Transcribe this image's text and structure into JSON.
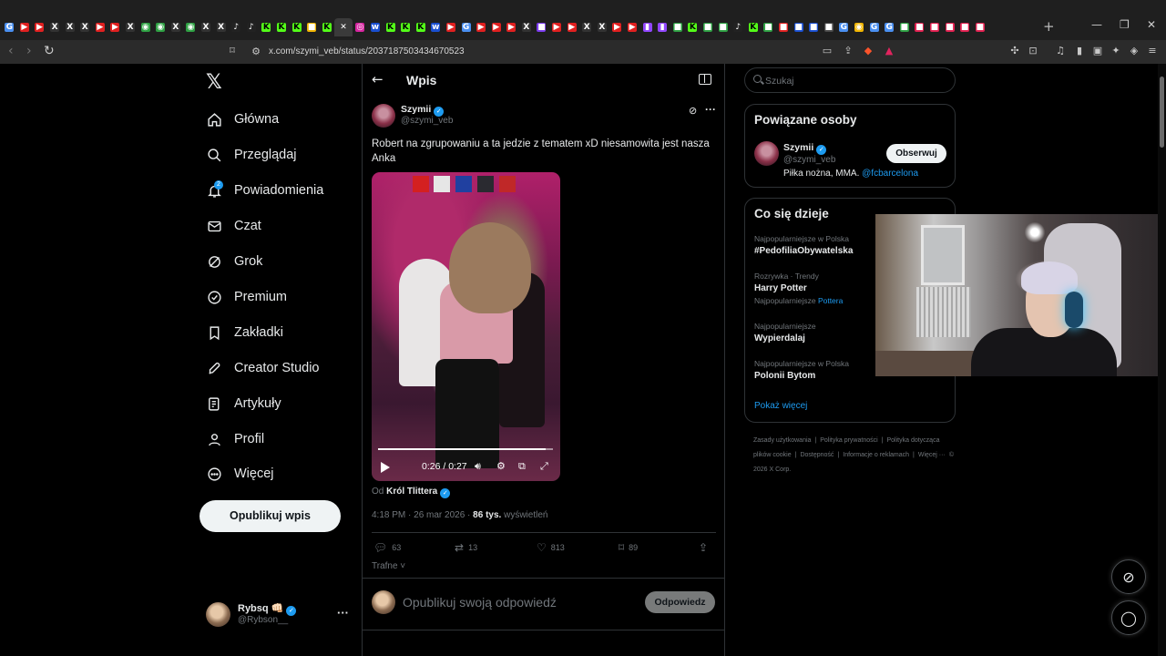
{
  "browser": {
    "tab_favicons": [
      {
        "icon": "google-icon",
        "color": "#4a8ff0"
      },
      {
        "icon": "youtube-icon",
        "color": "#e02020"
      },
      {
        "icon": "youtube-icon",
        "color": "#e02020"
      },
      {
        "icon": "x-icon",
        "color": "#333333"
      },
      {
        "icon": "x-icon",
        "color": "#333333"
      },
      {
        "icon": "x-icon",
        "color": "#333333"
      },
      {
        "icon": "youtube-icon",
        "color": "#e02020"
      },
      {
        "icon": "youtube-icon",
        "color": "#e02020"
      },
      {
        "icon": "x-icon",
        "color": "#333333"
      },
      {
        "icon": "maps-icon",
        "color": "#2ea043"
      },
      {
        "icon": "maps-icon",
        "color": "#2ea043"
      },
      {
        "icon": "x-icon",
        "color": "#333333"
      },
      {
        "icon": "maps-icon",
        "color": "#2ea043"
      },
      {
        "icon": "x-icon",
        "color": "#333333"
      },
      {
        "icon": "x-icon",
        "color": "#333333"
      },
      {
        "icon": "tiktok-icon",
        "color": "#222222"
      },
      {
        "icon": "tiktok-icon",
        "color": "#222222"
      },
      {
        "icon": "kick-icon",
        "color": "#53fc18"
      },
      {
        "icon": "kick-icon",
        "color": "#53fc18"
      },
      {
        "icon": "kick-icon",
        "color": "#53fc18"
      },
      {
        "icon": "app-icon",
        "color": "#f0b400"
      },
      {
        "icon": "kick-icon",
        "color": "#53fc18"
      },
      {
        "icon": "close-icon",
        "color": "#3a3a3a",
        "active": true
      },
      {
        "icon": "instagram-icon",
        "color": "#d6249f"
      },
      {
        "icon": "wp-icon",
        "color": "#1a4fd0"
      },
      {
        "icon": "kick-icon",
        "color": "#53fc18"
      },
      {
        "icon": "kick-icon",
        "color": "#53fc18"
      },
      {
        "icon": "kick-icon",
        "color": "#53fc18"
      },
      {
        "icon": "wp-icon",
        "color": "#1a4fd0"
      },
      {
        "icon": "youtube-icon",
        "color": "#e02020"
      },
      {
        "icon": "google-icon",
        "color": "#4a8ff0"
      },
      {
        "icon": "youtube-icon",
        "color": "#e02020"
      },
      {
        "icon": "youtube-icon",
        "color": "#e02020"
      },
      {
        "icon": "youtube-icon",
        "color": "#e02020"
      },
      {
        "icon": "x-icon",
        "color": "#333333"
      },
      {
        "icon": "app-icon",
        "color": "#7a3aed"
      },
      {
        "icon": "youtube-icon",
        "color": "#e02020"
      },
      {
        "icon": "youtube-icon",
        "color": "#e02020"
      },
      {
        "icon": "x-icon",
        "color": "#333333"
      },
      {
        "icon": "x-icon",
        "color": "#333333"
      },
      {
        "icon": "youtube-icon",
        "color": "#e02020"
      },
      {
        "icon": "youtube-icon",
        "color": "#e02020"
      },
      {
        "icon": "twitch-icon",
        "color": "#9146ff"
      },
      {
        "icon": "twitch-icon",
        "color": "#9146ff"
      },
      {
        "icon": "app-icon",
        "color": "#2ea043"
      },
      {
        "icon": "kick-icon",
        "color": "#53fc18"
      },
      {
        "icon": "app-icon",
        "color": "#2ea043"
      },
      {
        "icon": "app-icon",
        "color": "#2ea043"
      },
      {
        "icon": "tiktok-icon",
        "color": "#222222"
      },
      {
        "icon": "kick-icon",
        "color": "#53fc18"
      },
      {
        "icon": "app-icon",
        "color": "#2ea043"
      },
      {
        "icon": "app-icon",
        "color": "#e02020"
      },
      {
        "icon": "app-icon",
        "color": "#1a4fd0"
      },
      {
        "icon": "app-icon",
        "color": "#1a4fd0"
      },
      {
        "icon": "app-icon",
        "color": "#4a4a4a"
      },
      {
        "icon": "google-icon",
        "color": "#4a8ff0"
      },
      {
        "icon": "chrome-icon",
        "color": "#f0b400"
      },
      {
        "icon": "google-icon",
        "color": "#4a8ff0"
      },
      {
        "icon": "google-icon",
        "color": "#4a8ff0"
      },
      {
        "icon": "app-icon",
        "color": "#2ea043"
      },
      {
        "icon": "app-icon",
        "color": "#e02050"
      },
      {
        "icon": "app-icon",
        "color": "#e02050"
      },
      {
        "icon": "app-icon",
        "color": "#e02050"
      },
      {
        "icon": "app-icon",
        "color": "#e02050"
      },
      {
        "icon": "app-icon",
        "color": "#e02050"
      }
    ],
    "url": "x.com/szymi_veb/status/2037187503434670523",
    "colors": {
      "tabbar": "#1f1f1f",
      "toolbar": "#2b2b2b"
    }
  },
  "nav": {
    "items": [
      {
        "label": "Główna",
        "icon": "home-icon"
      },
      {
        "label": "Przeglądaj",
        "icon": "search-icon"
      },
      {
        "label": "Powiadomienia",
        "icon": "bell-icon",
        "badge": "2"
      },
      {
        "label": "Czat",
        "icon": "mail-icon"
      },
      {
        "label": "Grok",
        "icon": "grok-icon"
      },
      {
        "label": "Premium",
        "icon": "premium-icon"
      },
      {
        "label": "Zakładki",
        "icon": "bookmark-icon"
      },
      {
        "label": "Creator Studio",
        "icon": "rocket-icon"
      },
      {
        "label": "Artykuły",
        "icon": "article-icon"
      },
      {
        "label": "Profil",
        "icon": "person-icon"
      },
      {
        "label": "Więcej",
        "icon": "more-circle-icon"
      }
    ],
    "publish_label": "Opublikuj wpis",
    "account": {
      "name": "Rybsq 👊🏻",
      "handle": "@Rybson__"
    }
  },
  "post": {
    "header_title": "Wpis",
    "author_name": "Szymii",
    "author_handle": "@szymi_veb",
    "text": "Robert na zgrupowaniu a ta jedzie z tematem xD niesamowita jest nasza Anka",
    "video_time": "0:26 / 0:27",
    "video_progress": 0.96,
    "from_prefix": "Od",
    "from_account": "Król Tlittera",
    "time_date": "4:18 PM · 26 mar 2026 · ",
    "views_count": "86 tys.",
    "views_label": " wyświetleń",
    "actions": {
      "replies": "63",
      "reposts": "13",
      "likes": "813",
      "bookmarks": "89"
    },
    "sort_label": "Trafne",
    "reply_placeholder": "Opublikuj swoją odpowiedź",
    "reply_button": "Odpowiedz"
  },
  "sidebar": {
    "search_placeholder": "Szukaj",
    "related_title": "Powiązane osoby",
    "person": {
      "name": "Szymii",
      "handle": "@szymi_veb",
      "bio_text": "Piłka nożna, MMA. ",
      "bio_link": "@fcbarcelona",
      "follow_label": "Obserwuj"
    },
    "trends_title": "Co się dzieje",
    "trends": [
      {
        "category": "Najpopularniejsze w Polska",
        "name": "#PedofiliaObywatelska"
      },
      {
        "category": "Rozrywka · Trendy",
        "name": "Harry Potter",
        "sub_prefix": "Najpopularniejsze ",
        "sub_link": "Pottera"
      },
      {
        "category": "Najpopularniejsze",
        "name": "Wypierdalaj"
      },
      {
        "category": "Najpopularniejsze w Polska",
        "name": "Polonii Bytom"
      }
    ],
    "show_more": "Pokaż więcej",
    "footer": [
      "Zasady użytkowania",
      "|",
      "Polityka prywatności",
      "|",
      "Polityka dotycząca plików cookie",
      "|",
      "Dostępność",
      "|",
      "Informacje o reklamach",
      "|",
      "Więcej ···",
      "© 2026 X Corp."
    ]
  },
  "colors": {
    "accent": "#1d9bf0",
    "text": "#e7e9ea",
    "muted": "#71767b",
    "border": "#2f3336"
  }
}
